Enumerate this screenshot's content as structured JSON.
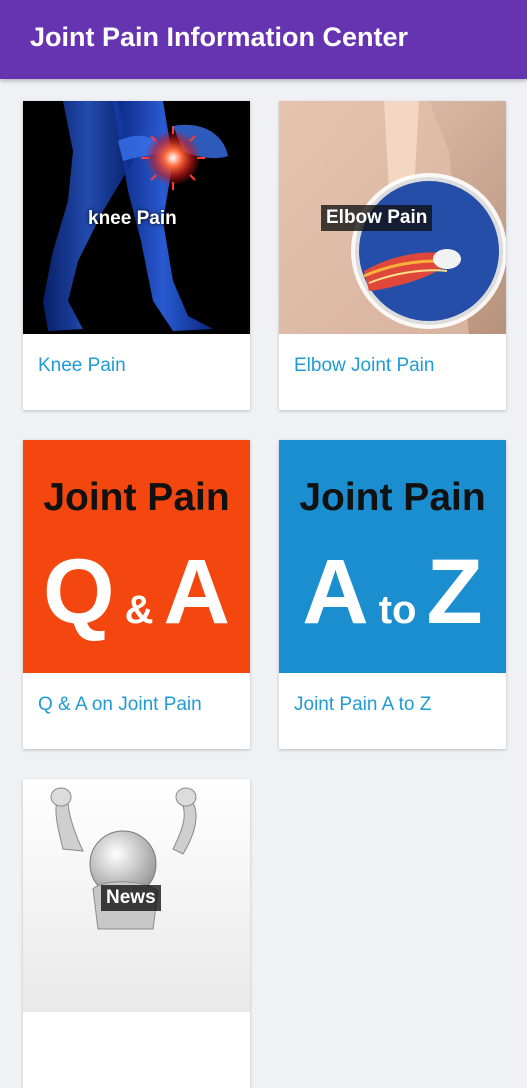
{
  "header": {
    "title": "Joint Pain Information Center"
  },
  "colors": {
    "appbar": "#6633b1",
    "link_text": "#1f9ad6",
    "qa_poster_bg": "#f4470f",
    "az_poster_bg": "#1a8ecf"
  },
  "cards": [
    {
      "label": "Knee Pain",
      "image_caption": "knee Pain",
      "icon": "knee-anatomy-image"
    },
    {
      "label": "Elbow Joint Pain",
      "image_caption": "Elbow Pain",
      "icon": "elbow-anatomy-image"
    },
    {
      "label": "Q & A on Joint Pain",
      "poster_heading": "Joint Pain",
      "poster_big_left": "Q",
      "poster_small": "&",
      "poster_big_right": "A",
      "icon": "qa-poster-image"
    },
    {
      "label": "Joint Pain A to Z",
      "poster_heading": "Joint Pain",
      "poster_big_left": "A",
      "poster_small": "to",
      "poster_big_right": "Z",
      "icon": "a-to-z-poster-image"
    },
    {
      "label": "",
      "image_caption": "News",
      "icon": "news-figure-image"
    }
  ]
}
